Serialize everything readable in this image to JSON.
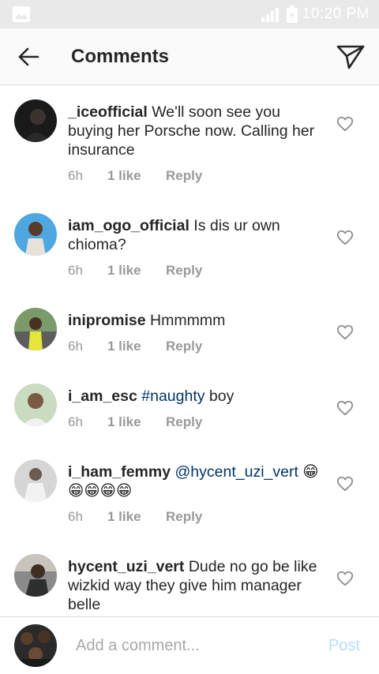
{
  "status_bar": {
    "time": "10:20 PM",
    "icons": [
      "image-icon",
      "signal-icon",
      "battery-charging-icon"
    ]
  },
  "header": {
    "title": "Comments",
    "back_icon": "arrow-left-icon",
    "send_icon": "paper-plane-icon"
  },
  "comments": [
    {
      "username": "_iceofficial",
      "text": "We'll soon see you buying her Porsche now. Calling her insurance",
      "tag": "",
      "rest": "",
      "time": "6h",
      "likes": "1 like",
      "reply": "Reply"
    },
    {
      "username": "iam_ogo_official",
      "text": "Is dis ur own chioma?",
      "tag": "",
      "rest": "",
      "time": "6h",
      "likes": "1 like",
      "reply": "Reply"
    },
    {
      "username": "inipromise",
      "text": "Hmmmmm",
      "tag": "",
      "rest": "",
      "time": "6h",
      "likes": "1 like",
      "reply": "Reply"
    },
    {
      "username": "i_am_esc",
      "text": "",
      "tag": "#naughty",
      "rest": "boy",
      "time": "6h",
      "likes": "1 like",
      "reply": "Reply"
    },
    {
      "username": "i_ham_femmy",
      "text": "",
      "tag": "@hycent_uzi_vert",
      "rest": "😁😁😁😁😁",
      "time": "6h",
      "likes": "1 like",
      "reply": "Reply"
    },
    {
      "username": "hycent_uzi_vert",
      "text": "Dude no go be like wizkid way they give him manager belle",
      "tag": "",
      "rest": "",
      "time": "",
      "likes": "",
      "reply": ""
    }
  ],
  "composer": {
    "placeholder": "Add a comment...",
    "post_label": "Post"
  },
  "colors": {
    "header_bg": "#fafafa",
    "tag": "#003569",
    "meta": "#999999",
    "post_disabled": "#b2dffc"
  }
}
